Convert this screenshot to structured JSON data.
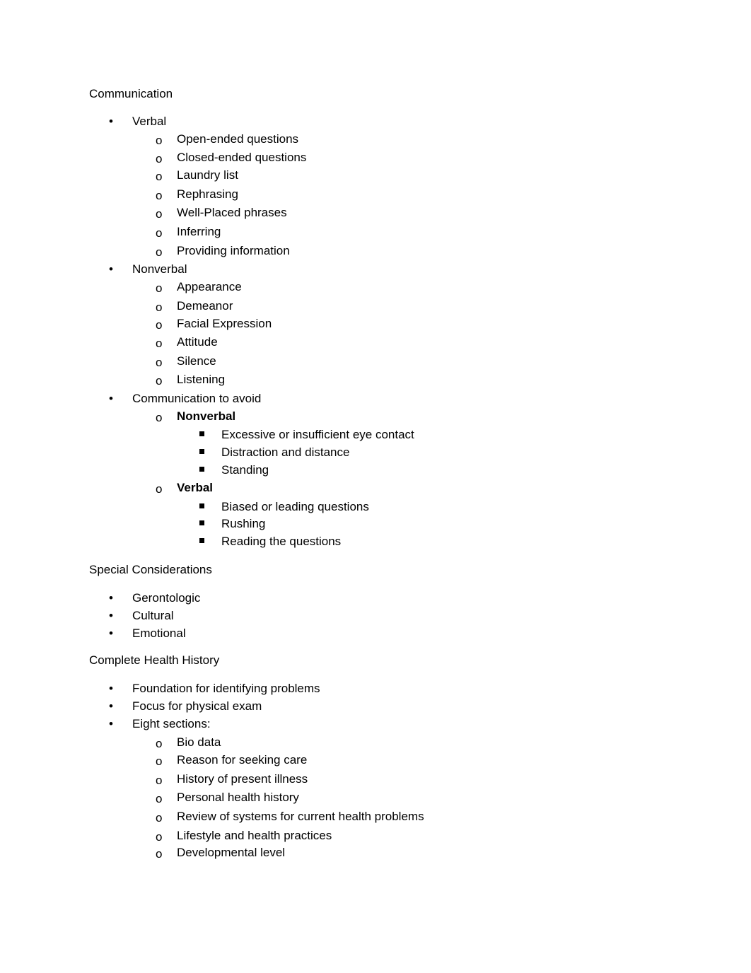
{
  "document": {
    "sections": [
      {
        "heading": "Communication",
        "items": [
          {
            "label": "Verbal",
            "children": [
              {
                "label": "Open-ended questions"
              },
              {
                "label": "Closed-ended questions"
              },
              {
                "label": "Laundry list"
              },
              {
                "label": "Rephrasing"
              },
              {
                "label": "Well-Placed phrases"
              },
              {
                "label": "Inferring"
              },
              {
                "label": "Providing information"
              }
            ]
          },
          {
            "label": "Nonverbal",
            "children": [
              {
                "label": "Appearance"
              },
              {
                "label": "Demeanor"
              },
              {
                "label": "Facial Expression"
              },
              {
                "label": "Attitude"
              },
              {
                "label": "Silence"
              },
              {
                "label": "Listening"
              }
            ]
          },
          {
            "label": "Communication to avoid",
            "children": [
              {
                "label": "Nonverbal",
                "bold": true,
                "children": [
                  {
                    "label": "Excessive or insufficient eye contact"
                  },
                  {
                    "label": "Distraction and distance"
                  },
                  {
                    "label": "Standing"
                  }
                ]
              },
              {
                "label": "Verbal",
                "bold": true,
                "children": [
                  {
                    "label": "Biased or leading questions"
                  },
                  {
                    "label": "Rushing"
                  },
                  {
                    "label": "Reading the questions"
                  }
                ]
              }
            ]
          }
        ]
      },
      {
        "heading": "Special Considerations",
        "items": [
          {
            "label": "Gerontologic"
          },
          {
            "label": "Cultural"
          },
          {
            "label": "Emotional"
          }
        ]
      },
      {
        "heading": "Complete Health History",
        "items": [
          {
            "label": "Foundation for identifying problems"
          },
          {
            "label": "Focus for physical exam"
          },
          {
            "label": "Eight sections:",
            "children": [
              {
                "label": "Bio data"
              },
              {
                "label": "Reason for seeking care"
              },
              {
                "label": "History of present illness"
              },
              {
                "label": "Personal health history"
              },
              {
                "label": "Review of systems for current health problems"
              },
              {
                "label": "Lifestyle and health practices"
              },
              {
                "label": "Developmental level"
              }
            ]
          }
        ]
      }
    ],
    "markers": {
      "level1": "•",
      "level2": "o",
      "level3": "▪"
    }
  }
}
